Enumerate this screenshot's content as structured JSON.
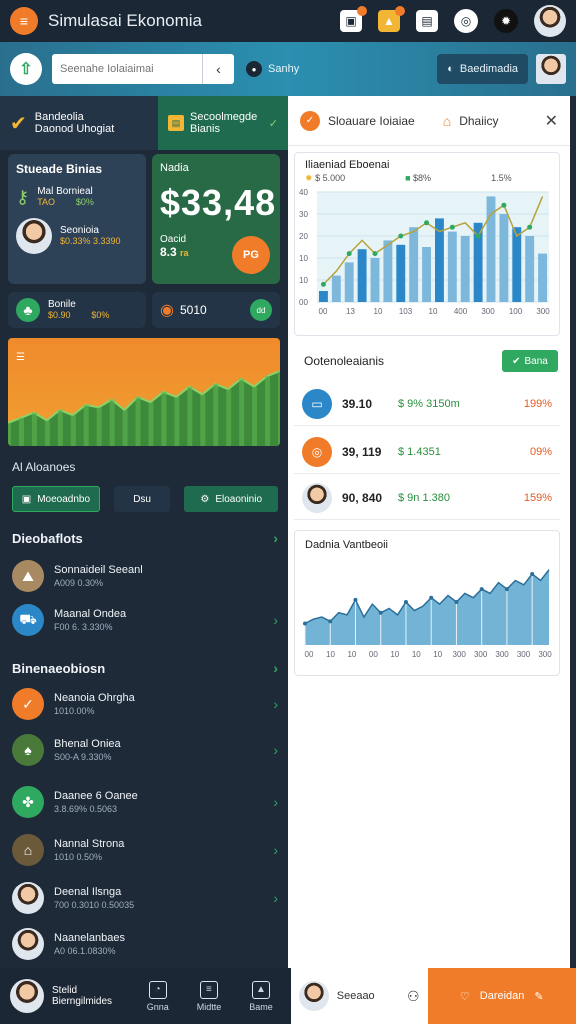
{
  "app": {
    "title": "Simulasai Ekonomia"
  },
  "topbar": {
    "icons": [
      "bag-icon",
      "bell-icon",
      "message-icon",
      "coin-icon",
      "dark-mode-icon"
    ]
  },
  "search": {
    "placeholder": "Seenahe Iolaiaimai",
    "status_text": "Sanhy",
    "account_label": "Baedimadia"
  },
  "left": {
    "header1": {
      "line1": "Bandeolia",
      "line2": "Daonod Uhogiat"
    },
    "header2": {
      "line1": "Secoolmegde",
      "line2": "Bianis"
    },
    "card1": {
      "label": "Stueade Binias",
      "row1_title": "Mal Bornieal",
      "row1_a": "TAO",
      "row1_b": "$0%",
      "row2_title": "Seonioia",
      "row2_a": "$0.33% 3.3390"
    },
    "card2": {
      "label": "Nadia",
      "amount": "$33,48",
      "sub": "Oacid",
      "sub_val": "8.3",
      "sub_unit": "ra",
      "coin_label": "PG"
    },
    "card3": {
      "title": "Bonile",
      "a": "$0.90",
      "b": "$0%"
    },
    "card4": {
      "value": "5010",
      "badge": "dd"
    },
    "actions_title": "Al Aloanoes",
    "actions": [
      "Moeoadnbo",
      "Dsu",
      "Eloaoninio"
    ],
    "section1": {
      "title": "Dieobaflots",
      "items": [
        {
          "title": "Sonnaideil Seeanl",
          "sub": "A009 0.30%"
        },
        {
          "title": "Maanal Ondea",
          "sub": "F00 6. 3.330%"
        }
      ]
    },
    "section2": {
      "title": "Binenaeobiosn",
      "items": [
        {
          "title": "Neanoia Ohrgha",
          "sub": "1010.00%"
        },
        {
          "title": "Bhenal Oniea",
          "sub": "S00-A 9.330%"
        },
        {
          "title": "Daanee 6 Oanee",
          "sub": "3.8.69% 0.5063"
        },
        {
          "title": "Nannal Strona",
          "sub": "1010 0.50%"
        },
        {
          "title": "Deenal Ilsnga",
          "sub": "700 0.3010 0.50035"
        },
        {
          "title": "Naanelanbaes",
          "sub": "A0 06.1.0830%"
        }
      ]
    }
  },
  "right": {
    "tab1": "Sloauare Ioiaiae",
    "tab2": "Dhaiicy",
    "chart1": {
      "title": "Iliaeniad Eboenai",
      "legend": [
        {
          "label": "$ 5.000"
        },
        {
          "label": "$8%"
        },
        {
          "label": "1.5%"
        }
      ],
      "yticks": [
        "40",
        "30",
        "20",
        "10",
        "10",
        "00"
      ],
      "xticks": [
        "00",
        "13",
        "10",
        "103",
        "10",
        "400",
        "300",
        "100",
        "300"
      ]
    },
    "section_title": "Ootenoleaianis",
    "section_btn": "Bana",
    "rows": [
      {
        "icon": "wallet-icon",
        "color": "#2b87c8",
        "value": "39.10",
        "mid": "$ 9%  3150m",
        "pct": "199%"
      },
      {
        "icon": "coin-icon",
        "color": "#f07c2a",
        "value": "39, 119",
        "mid": "$ 1.4351",
        "pct": "09%"
      },
      {
        "icon": "avatar-icon",
        "color": "#2fa860",
        "value": "90, 840",
        "mid": "$ 9n  1.380",
        "pct": "159%"
      }
    ],
    "chart2": {
      "title": "Dadnia Vantbeoii",
      "xticks": [
        "00",
        "10",
        "10",
        "00",
        "10",
        "10",
        "10",
        "300",
        "300",
        "300",
        "300",
        "300"
      ]
    }
  },
  "chart_data": [
    {
      "type": "bar",
      "title": "Iliaeniad Eboenai",
      "categories": [
        "00",
        "13",
        "10",
        "103",
        "10",
        "400",
        "300",
        "100",
        "300"
      ],
      "series": [
        {
          "values": [
            5,
            12,
            18,
            24,
            20,
            28,
            26,
            34,
            25,
            38,
            32,
            30,
            36,
            48,
            40,
            34,
            30,
            22
          ]
        }
      ],
      "line": [
        8,
        14,
        22,
        28,
        22,
        26,
        30,
        32,
        36,
        32,
        34,
        36,
        30,
        40,
        44,
        30,
        34,
        48
      ],
      "ylim": [
        0,
        50
      ]
    },
    {
      "type": "area",
      "title": "Dadnia Vantbeoii",
      "values": [
        20,
        24,
        26,
        22,
        30,
        28,
        42,
        26,
        38,
        30,
        34,
        28,
        40,
        32,
        36,
        44,
        38,
        46,
        40,
        48,
        44,
        52,
        48,
        58,
        52,
        60,
        56,
        66,
        60,
        70
      ],
      "ylim": [
        0,
        80
      ]
    },
    {
      "type": "area",
      "values": [
        10,
        14,
        18,
        12,
        20,
        16,
        24,
        22,
        28,
        20,
        30,
        26,
        34,
        30,
        38,
        32,
        40,
        36,
        44,
        38,
        46,
        50
      ],
      "ylim": [
        0,
        60
      ]
    }
  ],
  "bottom": {
    "user_line1": "Stelid",
    "user_line2": "Bierngilmides",
    "nav": [
      "Gnna",
      "Midtte",
      "Bame"
    ],
    "white_label": "Seeaao",
    "orange_label": "Dareidan"
  }
}
